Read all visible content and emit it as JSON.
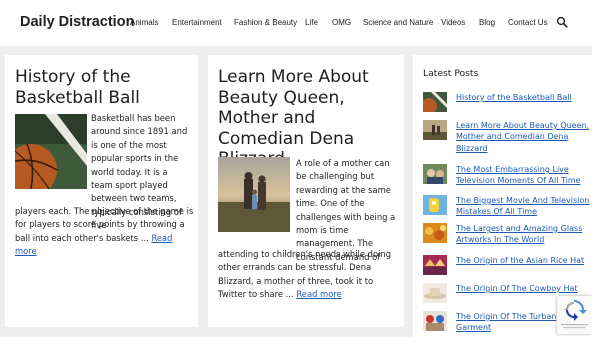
{
  "header": {
    "brand": "Daily Distraction",
    "nav": [
      "Animals",
      "Entertainment",
      "Fashion & Beauty",
      "Life",
      "OMG",
      "Science and Nature",
      "Videos",
      "Blog",
      "Contact Us"
    ],
    "search_icon": "search-icon"
  },
  "posts": [
    {
      "title": "History of the Basketball Ball",
      "excerpt_side": "Basketball has been around since 1891 and is one of the most popular sports in the world today. It is a team sport played between two teams, typically consisting of five",
      "excerpt_full": "players each. The objective of the game is for players to score points by throwing a ball into each other's baskets ...",
      "read_more": "Read more"
    },
    {
      "title": "Learn More About Beauty Queen, Mother and Comedian Dena Blizzard",
      "excerpt_side": "A role of a mother can be challenging but rewarding at the same time. One of the challenges with being a mom is time management. The constant demand of",
      "excerpt_full": "attending to children's needs while doing other errands can be stressful. Dena Blizzard, a mother of three, took it to Twitter to share ...",
      "read_more": "Read more"
    }
  ],
  "sidebar": {
    "title": "Latest Posts",
    "items": [
      "History of the Basketball Ball",
      "Learn More About Beauty Queen, Mother and Comedian Dena Blizzard",
      "The Most Embarrassing Live Television Moments Of All Time",
      "The Biggest Movie And Television Mistakes Of All Time",
      "The Largest and Amazing Glass Artworks In The World",
      "The Origin of the Asian Rice Hat",
      "The Origin Of The Cowboy Hat",
      "The Origin Of The Turban Garment"
    ]
  },
  "colors": {
    "link": "#1e5ab4",
    "background": "#efefef",
    "card": "#ffffff"
  }
}
